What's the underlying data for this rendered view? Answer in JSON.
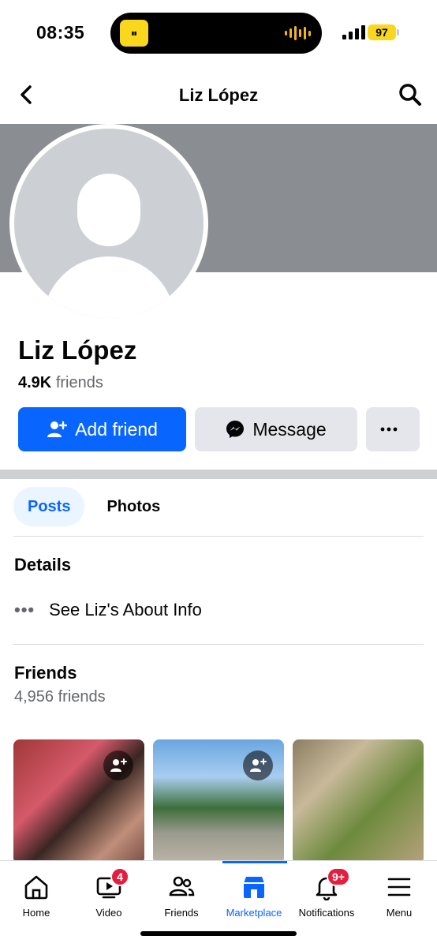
{
  "status": {
    "time": "08:35",
    "battery": "97"
  },
  "header": {
    "title": "Liz López"
  },
  "profile": {
    "name": "Liz López",
    "friends_count": "4.9K",
    "friends_word": "friends",
    "add_friend_label": "Add friend",
    "message_label": "Message"
  },
  "tabs": [
    {
      "label": "Posts"
    },
    {
      "label": "Photos"
    }
  ],
  "details": {
    "title": "Details",
    "about_label": "See Liz's About Info"
  },
  "friends": {
    "title": "Friends",
    "subtitle": "4,956 friends"
  },
  "nav": {
    "items": [
      {
        "label": "Home"
      },
      {
        "label": "Video",
        "badge": "4"
      },
      {
        "label": "Friends"
      },
      {
        "label": "Marketplace"
      },
      {
        "label": "Notifications",
        "badge": "9+"
      },
      {
        "label": "Menu"
      }
    ]
  },
  "colors": {
    "accent": "#0866ff",
    "badge": "#e41e3f",
    "cover": "#8a8d91"
  }
}
